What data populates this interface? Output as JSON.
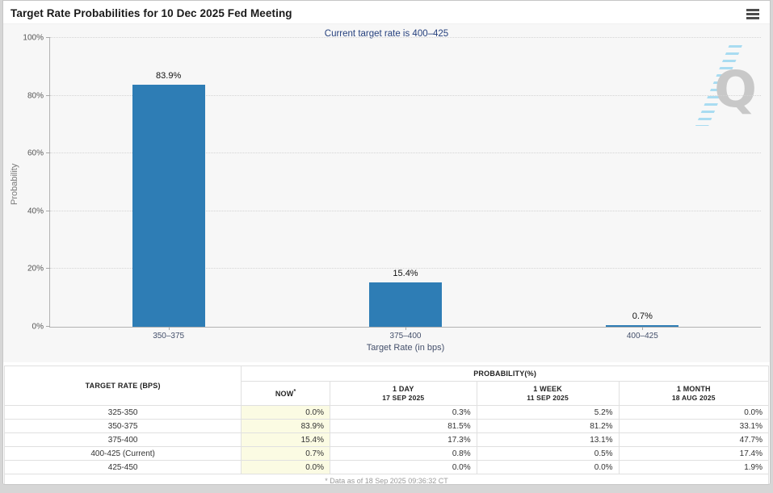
{
  "window": {
    "title": "Target Rate Probabilities for 10 Dec 2025 Fed Meeting"
  },
  "menu": {
    "icon": "hamburger-icon"
  },
  "chart": {
    "watermark_letter": "Q"
  },
  "chart_data": {
    "type": "bar",
    "title": "Target Rate Probabilities for 10 Dec 2025 Fed Meeting",
    "subtitle": "Current target rate is 400–425",
    "categories": [
      "350–375",
      "375–400",
      "400–425"
    ],
    "values": [
      83.9,
      15.4,
      0.7
    ],
    "value_labels": [
      "83.9%",
      "15.4%",
      "0.7%"
    ],
    "xlabel": "Target Rate (in bps)",
    "ylabel": "Probability",
    "ylim": [
      0,
      100
    ],
    "yticks": [
      0,
      20,
      40,
      60,
      80,
      100
    ],
    "ytick_labels": [
      "0%",
      "20%",
      "40%",
      "60%",
      "80%",
      "100%"
    ],
    "grid": "horizontal-dotted",
    "legend": "none",
    "bar_color": "#2e7db5"
  },
  "table": {
    "corner_header": "TARGET RATE (BPS)",
    "group_header": "PROBABILITY(%)",
    "columns": [
      {
        "label": "NOW",
        "sup": "*",
        "sub": ""
      },
      {
        "label": "1 DAY",
        "sub": "17 SEP 2025"
      },
      {
        "label": "1 WEEK",
        "sub": "11 SEP 2025"
      },
      {
        "label": "1 MONTH",
        "sub": "18 AUG 2025"
      }
    ],
    "rows": [
      {
        "rate": "325-350",
        "values": [
          "0.0%",
          "0.3%",
          "5.2%",
          "0.0%"
        ]
      },
      {
        "rate": "350-375",
        "values": [
          "83.9%",
          "81.5%",
          "81.2%",
          "33.1%"
        ]
      },
      {
        "rate": "375-400",
        "values": [
          "15.4%",
          "17.3%",
          "13.1%",
          "47.7%"
        ]
      },
      {
        "rate": "400-425 (Current)",
        "values": [
          "0.7%",
          "0.8%",
          "0.5%",
          "17.4%"
        ]
      },
      {
        "rate": "425-450",
        "values": [
          "0.0%",
          "0.0%",
          "0.0%",
          "1.9%"
        ]
      }
    ],
    "footnote": "* Data as of 18 Sep 2025 09:36:32 CT"
  },
  "colors": {
    "bar": "#2e7db5",
    "subtitle_text": "#26417e",
    "now_column_bg": "#fbfbe3",
    "chart_bg": "#f7f7f7",
    "axis_text": "#44506b",
    "footnote_text": "#9a9a9a"
  }
}
